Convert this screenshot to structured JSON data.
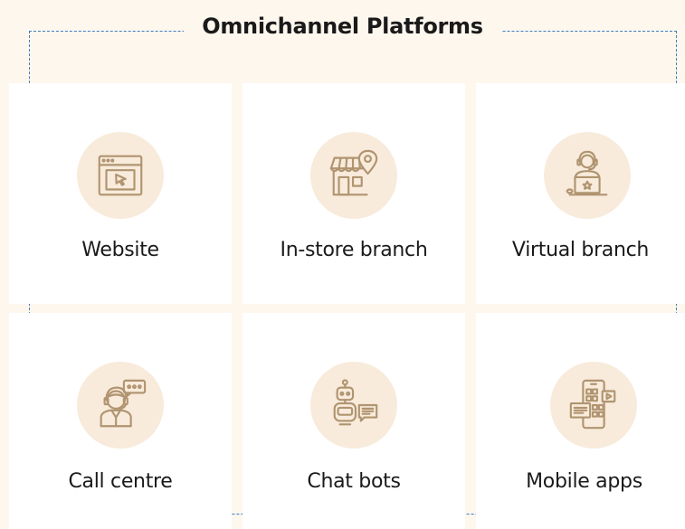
{
  "title": "Omnichannel Platforms",
  "colors": {
    "background": "#fdf7ee",
    "card": "#ffffff",
    "icon_bg": "#f8ebdb",
    "icon_stroke": "#b09470",
    "frame": "#3b7fc4"
  },
  "platforms": [
    {
      "label": "Website",
      "icon": "browser-cursor-icon"
    },
    {
      "label": "In-store branch",
      "icon": "store-location-icon"
    },
    {
      "label": "Virtual branch",
      "icon": "headset-laptop-icon"
    },
    {
      "label": "Call centre",
      "icon": "agent-chat-icon"
    },
    {
      "label": "Chat bots",
      "icon": "robot-chat-icon"
    },
    {
      "label": "Mobile apps",
      "icon": "mobile-apps-icon"
    }
  ]
}
